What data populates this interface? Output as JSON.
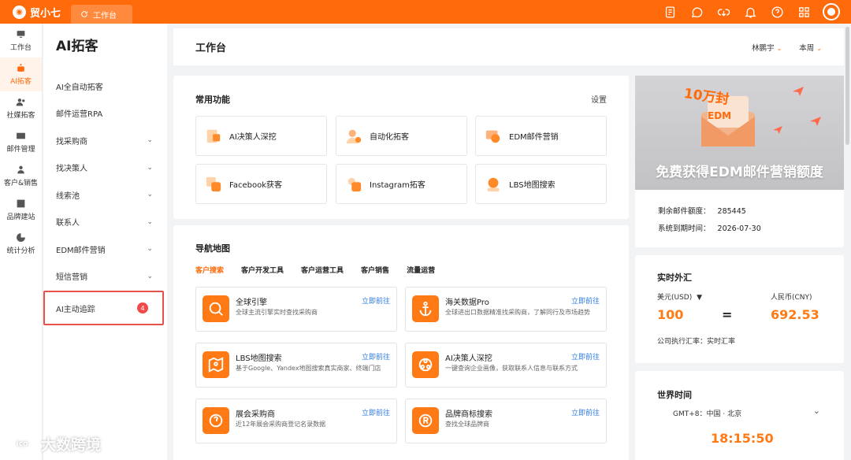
{
  "app": {
    "name": "贸小七",
    "active_tab": "工作台"
  },
  "rail": [
    {
      "label": "工作台",
      "icon": "monitor-icon"
    },
    {
      "label": "AI拓客",
      "icon": "robot-icon",
      "active": true
    },
    {
      "label": "社媒拓客",
      "icon": "users-icon"
    },
    {
      "label": "邮件管理",
      "icon": "mail-icon"
    },
    {
      "label": "客户&销售",
      "icon": "person-icon"
    },
    {
      "label": "品牌建站",
      "icon": "chart-icon"
    },
    {
      "label": "统计分析",
      "icon": "pie-icon"
    }
  ],
  "submenu": {
    "title": "AI拓客",
    "items": [
      {
        "label": "AI全自动拓客"
      },
      {
        "label": "邮件运营RPA"
      },
      {
        "label": "找采购商",
        "chevron": "⌄"
      },
      {
        "label": "找决策人",
        "chevron": "⌄"
      },
      {
        "label": "线索池",
        "chevron": "⌄"
      },
      {
        "label": "联系人",
        "chevron": "⌄"
      },
      {
        "label": "EDM邮件营销",
        "chevron": "⌄"
      },
      {
        "label": "短信营销",
        "chevron": "⌄"
      }
    ],
    "track": {
      "label": "AI主动追踪",
      "badge": "4"
    }
  },
  "header": {
    "title": "工作台",
    "user": "林鹏宇",
    "period": "本周",
    "chevron": "⌄"
  },
  "functions": {
    "title": "常用功能",
    "setting": "设置",
    "items": [
      {
        "label": "AI决策人深挖"
      },
      {
        "label": "自动化拓客"
      },
      {
        "label": "EDM邮件营销"
      },
      {
        "label": "Facebook获客"
      },
      {
        "label": "Instagram拓客"
      },
      {
        "label": "LBS地图搜索"
      }
    ]
  },
  "navmap": {
    "title": "导航地图",
    "tabs": [
      "客户搜索",
      "客户开发工具",
      "客户运营工具",
      "客户销售",
      "流量运营"
    ],
    "go": "立即前往",
    "items": [
      {
        "title": "全球引擎",
        "desc": "全球主流引擎实时查找采购商"
      },
      {
        "title": "海关数据Pro",
        "desc": "全球进出口数据精准找采购商，了解同行及市场趋势"
      },
      {
        "title": "LBS地图搜索",
        "desc": "基于Google、Yandex地图搜索真实商家、终端门店"
      },
      {
        "title": "AI决策人深挖",
        "desc": "一键查询企业画像，获取联系人信息与联系方式"
      },
      {
        "title": "展会采购商",
        "desc": "近12年展会采购商登记名录数据"
      },
      {
        "title": "品牌商标搜索",
        "desc": "查找全球品牌商"
      }
    ]
  },
  "edm": {
    "banner_title": "10万封",
    "banner_sub": "EDM",
    "banner_text": "免费获得EDM邮件营销额度",
    "quota_label": "剩余邮件额度：",
    "quota": "285445",
    "expire_label": "系统到期时间：",
    "expire": "2026-07-30"
  },
  "fx": {
    "title": "实时外汇",
    "from_label": "美元(USD)",
    "from_arrow": "▼",
    "to_label": "人民币(CNY)",
    "from_value": "100",
    "eq": "=",
    "to_value": "692.53",
    "note": "公司执行汇率：实时汇率"
  },
  "world_time": {
    "title": "世界时间",
    "zone": "GMT+8：中国 · 北京",
    "chevron": "⌄",
    "time": "18:15:50"
  },
  "watermark": {
    "mark": "ico",
    "text": "大数跨境"
  },
  "colors": {
    "brand": "#ff6a0a",
    "link": "#2d7be5",
    "badge": "#f04a4a"
  }
}
